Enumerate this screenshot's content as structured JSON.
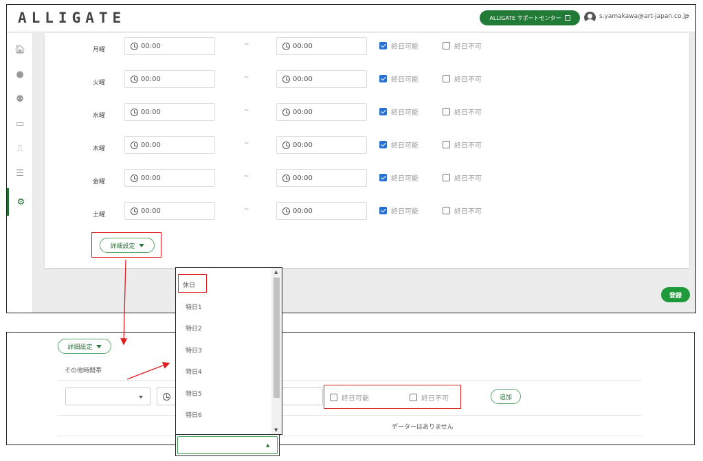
{
  "header": {
    "logo": "ALLIGATE",
    "support_label": "ALLIGATE サポートセンター",
    "user_email": "s.yamakawa@art-japan.co.jp"
  },
  "sidebar": {
    "items": [
      {
        "icon": "home-icon"
      },
      {
        "icon": "user-icon"
      },
      {
        "icon": "users-icon"
      },
      {
        "icon": "id-card-icon"
      },
      {
        "icon": "door-icon"
      },
      {
        "icon": "list-icon"
      },
      {
        "icon": "gear-icon",
        "active": true
      }
    ]
  },
  "schedule": {
    "rows": [
      {
        "day": "月曜",
        "start": "00:00",
        "end": "00:00",
        "allday_ok": true,
        "allday_ng": false
      },
      {
        "day": "火曜",
        "start": "00:00",
        "end": "00:00",
        "allday_ok": true,
        "allday_ng": false
      },
      {
        "day": "水曜",
        "start": "00:00",
        "end": "00:00",
        "allday_ok": true,
        "allday_ng": false
      },
      {
        "day": "木曜",
        "start": "00:00",
        "end": "00:00",
        "allday_ok": true,
        "allday_ng": false
      },
      {
        "day": "金曜",
        "start": "00:00",
        "end": "00:00",
        "allday_ok": true,
        "allday_ng": false
      },
      {
        "day": "土曜",
        "start": "00:00",
        "end": "00:00",
        "allday_ok": true,
        "allday_ng": false
      }
    ],
    "separator": "~",
    "allday_ok_label": "終日可能",
    "allday_ng_label": "終日不可"
  },
  "detail_label": "詳細設定",
  "register_label": "登録",
  "bottom": {
    "detail_label": "詳細設定",
    "section_title": "その他時間帯",
    "allday_ok_label": "終日可能",
    "allday_ng_label": "終日不可",
    "add_label": "追加",
    "empty_text": "データーはありません"
  },
  "dropdown": {
    "options": [
      "休日",
      "特日1",
      "特日2",
      "特日3",
      "特日4",
      "特日5",
      "特日6"
    ]
  },
  "colors": {
    "brand_green": "#217a35",
    "annotation_red": "#e02020",
    "checkbox_blue": "#2a6fd3"
  }
}
